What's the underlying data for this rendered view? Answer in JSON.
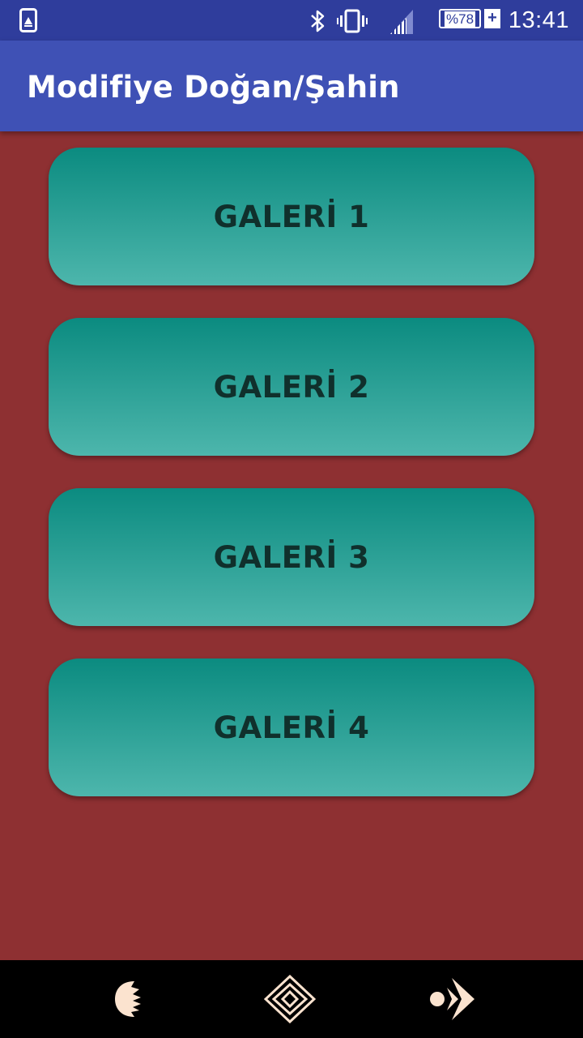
{
  "status_bar": {
    "notification_icon": "photo-notification-icon",
    "bluetooth_icon": "bluetooth-icon",
    "vibrate_icon": "vibrate-icon",
    "signal_icon": "cell-signal-icon",
    "battery_label": "%78",
    "battery_level": 0.78,
    "battery_charging_symbol": "+",
    "time": "13:41"
  },
  "app_bar": {
    "title": "Modifiye Doğan/Şahin"
  },
  "galleries": [
    {
      "label": "GALERİ 1"
    },
    {
      "label": "GALERİ 2"
    },
    {
      "label": "GALERİ 3"
    },
    {
      "label": "GALERİ 4"
    }
  ],
  "nav_bar": {
    "back_icon": "back-icon",
    "home_icon": "home-icon",
    "recents_icon": "recents-icon"
  },
  "colors": {
    "status_bar": "#2f3d9c",
    "app_bar": "#3f51b5",
    "background": "#8e3032",
    "button_top": "#0b8b80",
    "button_bottom": "#4db6ac",
    "button_text": "#10302c",
    "nav_icon": "#fbe3cf"
  }
}
